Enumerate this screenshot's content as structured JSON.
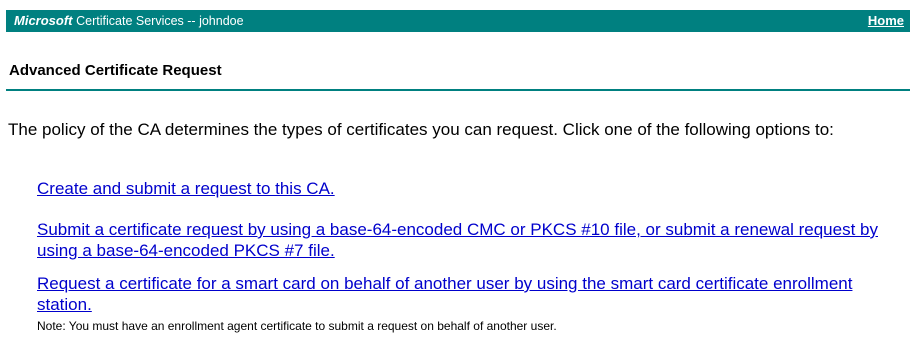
{
  "header": {
    "brand": "Microsoft",
    "service": "Certificate Services  --  johndoe",
    "home_link": "Home"
  },
  "page": {
    "title": "Advanced Certificate Request",
    "intro": "The policy of the CA determines the types of certificates you can request. Click one of the following options to:",
    "options": [
      "Create and submit a request to this CA.",
      "Submit a certificate request by using a base-64-encoded CMC or PKCS #10 file, or submit a renewal request by using a base-64-encoded PKCS #7 file.",
      "Request a certificate for a smart card on behalf of another user by using the smart card certificate enrollment station."
    ],
    "note": "Note: You must have an enrollment agent certificate to submit a request on behalf of another user."
  },
  "colors": {
    "header_bg": "#008080",
    "link": "#0000cc"
  }
}
